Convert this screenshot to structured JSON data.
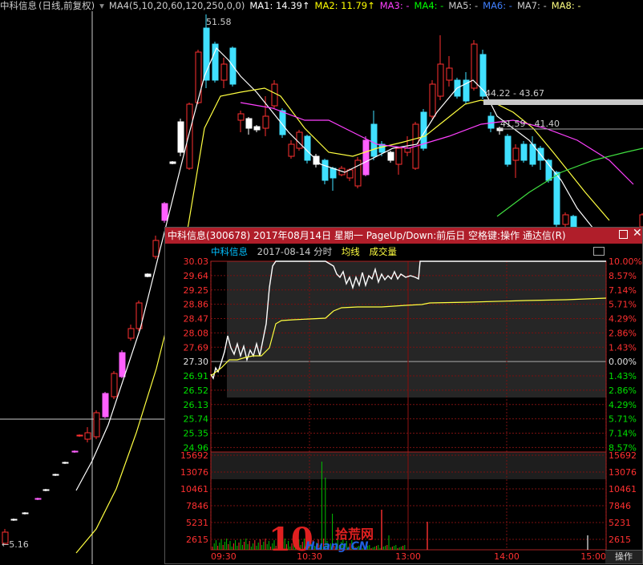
{
  "main_chart": {
    "stock_name": "中科信息",
    "mode": "(日线,前复权)",
    "ma_indicator": "MA4(5,10,20,60,120,250,0,0)",
    "ma_items": [
      {
        "text": "MA1: 14.39↑",
        "color": "#ffffff"
      },
      {
        "text": "MA2: 11.79↑",
        "color": "#ffff00"
      },
      {
        "text": "MA3: -",
        "color": "#ff40ff"
      },
      {
        "text": "MA4: -",
        "color": "#00ff00"
      },
      {
        "text": "MA5: -",
        "color": "#cccccc"
      },
      {
        "text": "MA6: -",
        "color": "#4080ff"
      },
      {
        "text": "MA7: -",
        "color": "#cccccc"
      },
      {
        "text": "MA8: -",
        "color": "#ffff80"
      }
    ],
    "high_label": "51.58",
    "low_label": "5.16",
    "range_label_1": "44.22 - 43.67",
    "range_label_2": "41.59 - 41.40"
  },
  "popup": {
    "title": "中科信息(300678) 2017年08月14日 星期一 PageUp/Down:前后日 空格键:操作 通达信(R)",
    "stock_label": "中科信息",
    "date_label": "2017-08-14 分时",
    "avg_label": "均线",
    "volume_label": "成交量",
    "price_ticks": [
      "30.03",
      "29.64",
      "29.25",
      "28.86",
      "28.47",
      "28.08",
      "27.69",
      "27.30",
      "26.91",
      "26.52",
      "26.13",
      "25.74",
      "25.35",
      "24.96"
    ],
    "pct_ticks": [
      "10.00%",
      "8.57%",
      "7.14%",
      "5.71%",
      "4.29%",
      "2.86%",
      "1.43%",
      "0.00%",
      "1.43%",
      "2.86%",
      "4.29%",
      "5.71%",
      "7.14%",
      "8.57%"
    ],
    "volume_ticks": [
      "15692",
      "13076",
      "10461",
      "7846",
      "5231",
      "2615"
    ],
    "time_ticks": [
      "09:30",
      "10:30",
      "13:00",
      "14:00",
      "15:00"
    ],
    "operate_button": "操作",
    "colors": {
      "up": "#ff3030",
      "down": "#00e000",
      "flat": "#e0e0e0",
      "avg": "#ffff40",
      "title_bg": "#b01e2a"
    }
  },
  "watermark": {
    "big": "10",
    "cn": "拾荒网",
    "en": "Huang.CN"
  }
}
